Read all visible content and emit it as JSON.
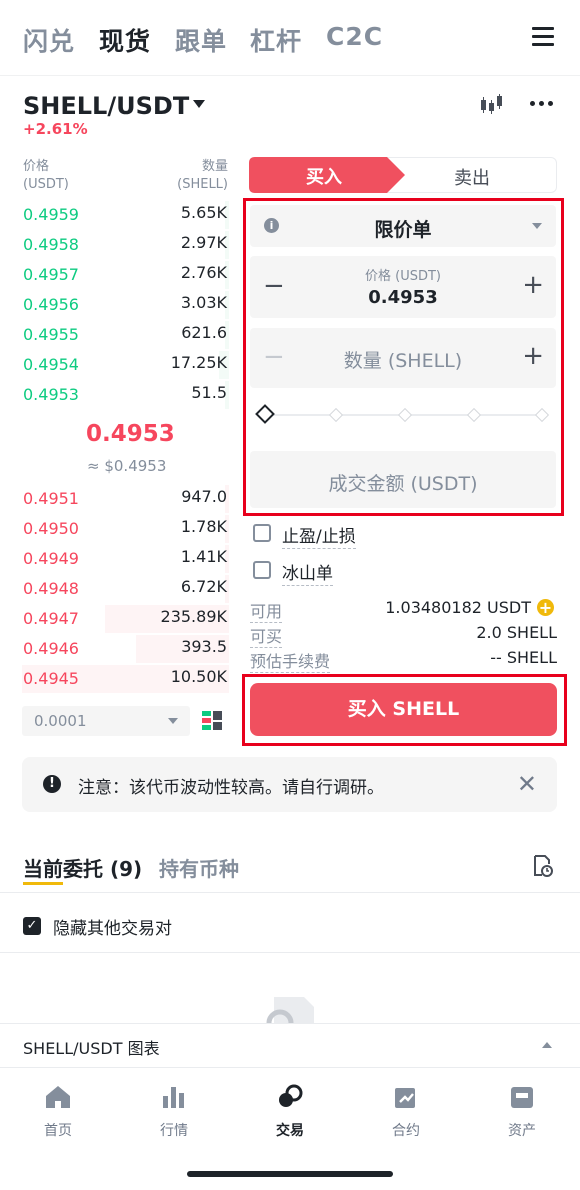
{
  "top_tabs": [
    {
      "label": "闪兑",
      "active": false
    },
    {
      "label": "现货",
      "active": true
    },
    {
      "label": "跟单",
      "active": false
    },
    {
      "label": "杠杆",
      "active": false
    },
    {
      "label": "C2C",
      "active": false
    }
  ],
  "pair": {
    "name": "SHELL/USDT",
    "change": "+2.61%"
  },
  "orderbook": {
    "price_header": "价格",
    "price_unit": "(USDT)",
    "qty_header": "数量",
    "qty_unit": "(SHELL)",
    "bids": [
      {
        "price": "0.4959",
        "qty": "5.65K",
        "depth": 0.02
      },
      {
        "price": "0.4958",
        "qty": "2.97K",
        "depth": 0.02
      },
      {
        "price": "0.4957",
        "qty": "2.76K",
        "depth": 0.02
      },
      {
        "price": "0.4956",
        "qty": "3.03K",
        "depth": 0.02
      },
      {
        "price": "0.4955",
        "qty": "621.6",
        "depth": 0.02
      },
      {
        "price": "0.4954",
        "qty": "17.25K",
        "depth": 0.05
      },
      {
        "price": "0.4953",
        "qty": "51.5",
        "depth": 0.02
      }
    ],
    "mid_price": "0.4953",
    "mid_usd": "≈ $0.4953",
    "asks": [
      {
        "price": "0.4951",
        "qty": "947.0",
        "depth": 0.02
      },
      {
        "price": "0.4950",
        "qty": "1.78K",
        "depth": 0.02
      },
      {
        "price": "0.4949",
        "qty": "1.41K",
        "depth": 0.02
      },
      {
        "price": "0.4948",
        "qty": "6.72K",
        "depth": 0.02
      },
      {
        "price": "0.4947",
        "qty": "235.89K",
        "depth": 0.6
      },
      {
        "price": "0.4946",
        "qty": "393.5",
        "depth": 0.45
      },
      {
        "price": "0.4945",
        "qty": "10.50K",
        "depth": 1.0
      }
    ],
    "precision": "0.0001"
  },
  "trade": {
    "buy_label": "买入",
    "sell_label": "卖出",
    "order_type": "限价单",
    "price_label": "价格 (USDT)",
    "price_value": "0.4953",
    "minus": "−",
    "plus": "+",
    "qty_placeholder": "数量 (SHELL)",
    "total_placeholder": "成交金额 (USDT)",
    "tp_sl": "止盈/止损",
    "iceberg": "冰山单",
    "available_label": "可用",
    "available_value": "1.03480182 USDT",
    "can_buy_label": "可买",
    "can_buy_value": "2.0 SHELL",
    "fee_label": "预估手续费",
    "fee_value": "-- SHELL",
    "submit": "买入 SHELL"
  },
  "notice": {
    "text": "注意：该代币波动性较高。请自行调研。"
  },
  "orders": {
    "tab_open": "当前委托 (9)",
    "tab_holdings": "持有币种",
    "hide_other": "隐藏其他交易对"
  },
  "chart_bar": {
    "label": "SHELL/USDT 图表"
  },
  "bottom_nav": [
    {
      "label": "首页",
      "icon": "home-icon",
      "active": false
    },
    {
      "label": "行情",
      "icon": "markets-icon",
      "active": false
    },
    {
      "label": "交易",
      "icon": "trade-icon",
      "active": true
    },
    {
      "label": "合约",
      "icon": "futures-icon",
      "active": false
    },
    {
      "label": "资产",
      "icon": "wallet-icon",
      "active": false
    }
  ],
  "colors": {
    "buy": "#0ecb81",
    "sell": "#f6465d",
    "accent": "#f0b90b",
    "highlight_box": "#e8001c"
  }
}
